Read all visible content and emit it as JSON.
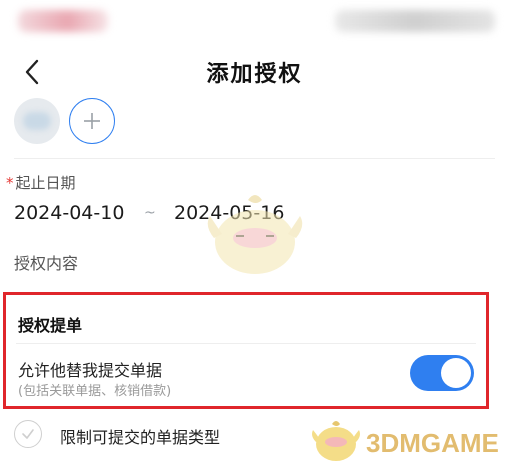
{
  "header": {
    "title": "添加授权"
  },
  "date_range": {
    "required_mark": "*",
    "label": "起止日期",
    "start": "2024-04-10",
    "separator": "~",
    "end": "2024-05-16"
  },
  "content": {
    "label": "授权内容"
  },
  "submit_section": {
    "title": "授权提单",
    "allow_label": "允许他替我提交单据",
    "allow_hint": "(包括关联单据、核销借款)",
    "allow_enabled": true
  },
  "restrict": {
    "label": "限制可提交的单据类型",
    "checked": false
  },
  "watermark": {
    "text": "3DMGAME"
  },
  "colors": {
    "accent": "#2f7ff0",
    "highlight": "#e0262b",
    "required": "#e53935"
  }
}
